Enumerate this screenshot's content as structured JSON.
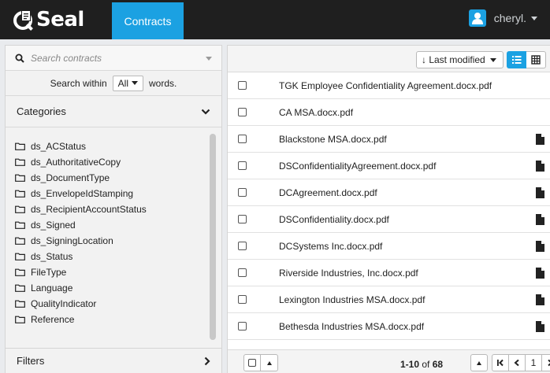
{
  "app": {
    "logo_text": "Seal",
    "active_tab": "Contracts",
    "user": "cheryl.",
    "accent": "#1ba1e2"
  },
  "sidebar": {
    "search_placeholder": "Search contracts",
    "search_within_prefix": "Search within",
    "search_within_value": "All",
    "search_within_suffix": "words.",
    "categories_label": "Categories",
    "categories": [
      "ds_ACStatus",
      "ds_AuthoritativeCopy",
      "ds_DocumentType",
      "ds_EnvelopeIdStamping",
      "ds_RecipientAccountStatus",
      "ds_Signed",
      "ds_SigningLocation",
      "ds_Status",
      "FileType",
      "Language",
      "QualityIndicator",
      "Reference"
    ],
    "filters_label": "Filters"
  },
  "toolbar": {
    "sort_label": "↓ Last modified"
  },
  "documents": [
    {
      "name": "TGK Employee Confidentiality Agreement.docx.pdf",
      "has_icon": false
    },
    {
      "name": "CA MSA.docx.pdf",
      "has_icon": false
    },
    {
      "name": "Blackstone MSA.docx.pdf",
      "has_icon": true
    },
    {
      "name": "DSConfidentialityAgreement.docx.pdf",
      "has_icon": true
    },
    {
      "name": "DCAgreement.docx.pdf",
      "has_icon": true
    },
    {
      "name": "DSConfidentiality.docx.pdf",
      "has_icon": true
    },
    {
      "name": "DCSystems Inc.docx.pdf",
      "has_icon": true
    },
    {
      "name": "Riverside Industries, Inc.docx.pdf",
      "has_icon": true
    },
    {
      "name": "Lexington Industries MSA.docx.pdf",
      "has_icon": true
    },
    {
      "name": "Bethesda Industries MSA.docx.pdf",
      "has_icon": true
    }
  ],
  "pager": {
    "range": "1-10",
    "of_word": "of",
    "total": "68",
    "page": "1"
  }
}
